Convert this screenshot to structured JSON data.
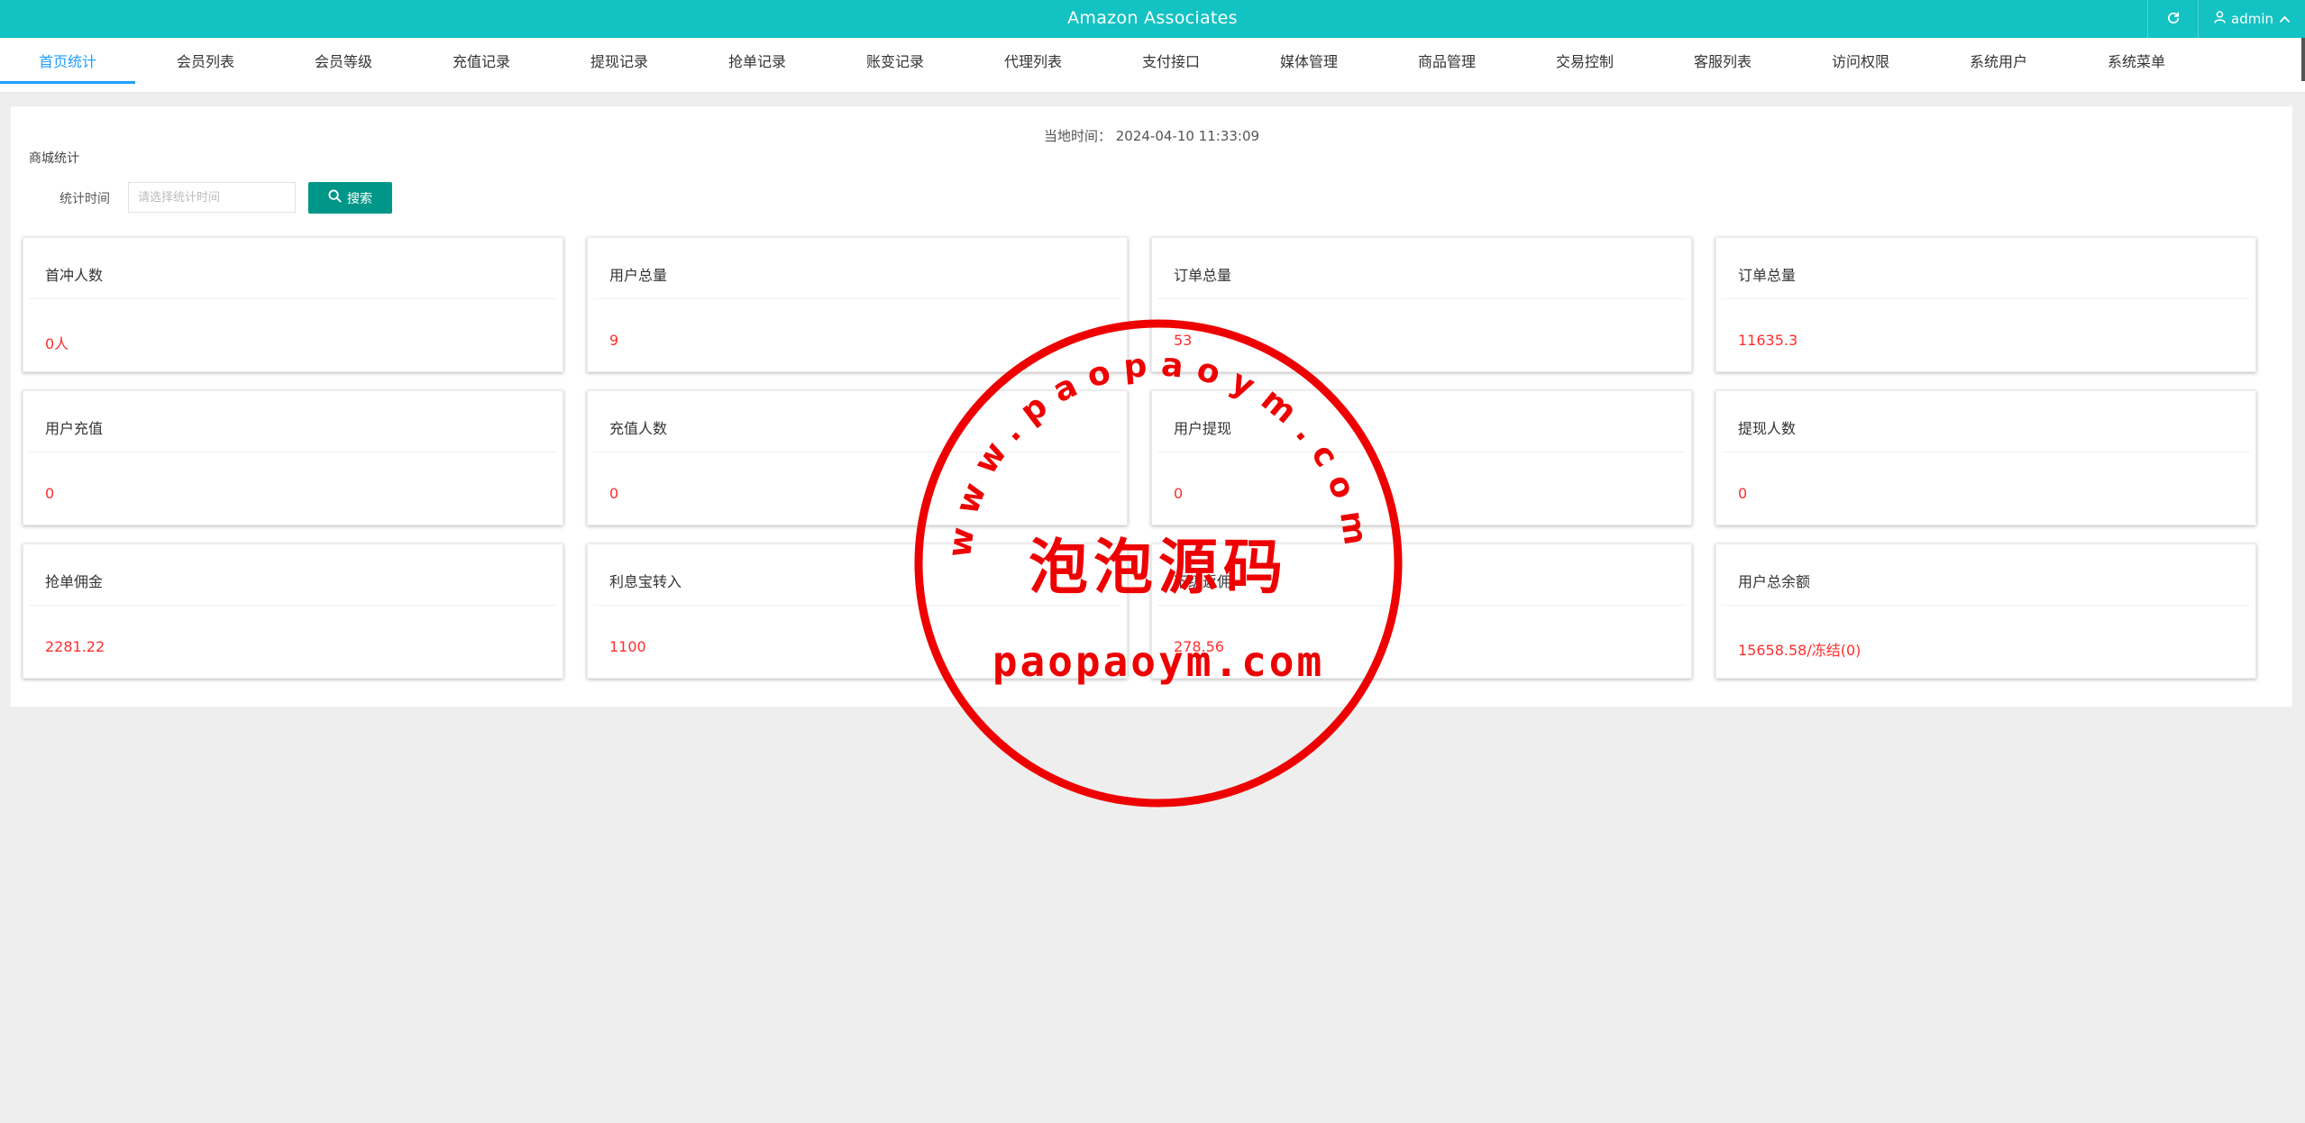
{
  "header": {
    "title": "Amazon Associates",
    "user_name": "admin"
  },
  "nav": {
    "tabs": [
      {
        "label": "首页统计",
        "active": true
      },
      {
        "label": "会员列表"
      },
      {
        "label": "会员等级"
      },
      {
        "label": "充值记录"
      },
      {
        "label": "提现记录"
      },
      {
        "label": "抢单记录"
      },
      {
        "label": "账变记录"
      },
      {
        "label": "代理列表"
      },
      {
        "label": "支付接口"
      },
      {
        "label": "媒体管理"
      },
      {
        "label": "商品管理"
      },
      {
        "label": "交易控制"
      },
      {
        "label": "客服列表"
      },
      {
        "label": "访问权限"
      },
      {
        "label": "系统用户"
      },
      {
        "label": "系统菜单"
      }
    ]
  },
  "main": {
    "local_time_label": "当地时间：",
    "local_time_value": "2024-04-10 11:33:09",
    "section_title": "商城统计",
    "filter": {
      "label": "统计时间",
      "placeholder": "请选择统计时间",
      "search_label": "搜索"
    },
    "cards": [
      {
        "title": "首冲人数",
        "value": "0人"
      },
      {
        "title": "用户总量",
        "value": "9"
      },
      {
        "title": "订单总量",
        "value": "53"
      },
      {
        "title": "订单总量",
        "value": "11635.3"
      },
      {
        "title": "用户充值",
        "value": "0"
      },
      {
        "title": "充值人数",
        "value": "0"
      },
      {
        "title": "用户提现",
        "value": "0"
      },
      {
        "title": "提现人数",
        "value": "0"
      },
      {
        "title": "抢单佣金",
        "value": "2281.22"
      },
      {
        "title": "利息宝转入",
        "value": "1100"
      },
      {
        "title": "下级返佣",
        "value": "278.56"
      },
      {
        "title": "用户总余额",
        "value": "15658.58/冻结(0)"
      }
    ]
  },
  "watermark": {
    "arc_text": "www.paopaoym.com",
    "center_text": "泡泡源码",
    "bottom_text": "paopaoym.com",
    "color": "#ee0000"
  },
  "colors": {
    "header_bg": "#13c2c3",
    "tab_active": "#1e9fff",
    "button_bg": "#009688",
    "value_red": "#ff2d2d"
  },
  "icons": {
    "refresh": "refresh-icon",
    "user": "user-icon",
    "chevron": "chevron-up-icon",
    "search": "search-icon"
  }
}
